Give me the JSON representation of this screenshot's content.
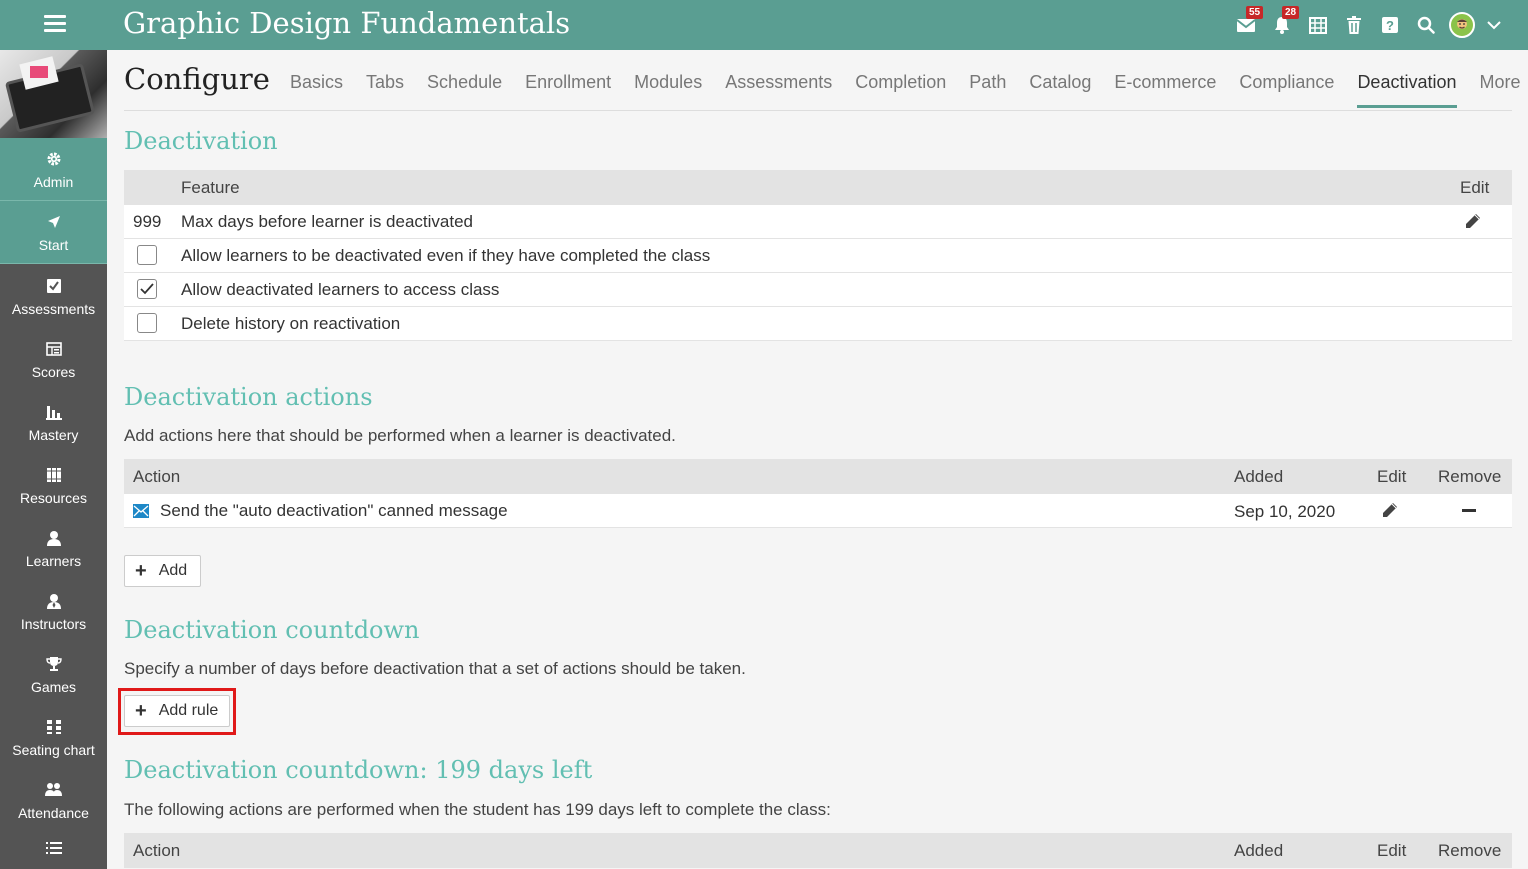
{
  "header": {
    "title": "Graphic Design Fundamentals",
    "mail_badge": "55",
    "notifications_badge": "28"
  },
  "sidebar": {
    "items": [
      {
        "label": "Admin",
        "icon": "gear-icon"
      },
      {
        "label": "Start",
        "icon": "arrow-icon"
      },
      {
        "label": "Assessments",
        "icon": "checklist-icon"
      },
      {
        "label": "Scores",
        "icon": "gradebook-icon"
      },
      {
        "label": "Mastery",
        "icon": "bar-chart-icon"
      },
      {
        "label": "Resources",
        "icon": "books-icon"
      },
      {
        "label": "Learners",
        "icon": "user-icon"
      },
      {
        "label": "Instructors",
        "icon": "instructor-icon"
      },
      {
        "label": "Games",
        "icon": "trophy-icon"
      },
      {
        "label": "Seating chart",
        "icon": "seating-icon"
      },
      {
        "label": "Attendance",
        "icon": "attendance-icon"
      },
      {
        "label": "",
        "icon": "list-icon"
      }
    ]
  },
  "page": {
    "title": "Configure",
    "tabs": [
      "Basics",
      "Tabs",
      "Schedule",
      "Enrollment",
      "Modules",
      "Assessments",
      "Completion",
      "Path",
      "Catalog",
      "E-commerce",
      "Compliance",
      "Deactivation",
      "More"
    ],
    "active_tab": "Deactivation"
  },
  "deactivation": {
    "heading": "Deactivation",
    "col_feature": "Feature",
    "col_edit": "Edit",
    "max_days_value": "999",
    "max_days_label": "Max days before learner is deactivated",
    "options": [
      {
        "label": "Allow learners to be deactivated even if they have completed the class",
        "checked": false
      },
      {
        "label": "Allow deactivated learners to access class",
        "checked": true
      },
      {
        "label": "Delete history on reactivation",
        "checked": false
      }
    ]
  },
  "actions": {
    "heading": "Deactivation actions",
    "description": "Add actions here that should be performed when a learner is deactivated.",
    "col_action": "Action",
    "col_added": "Added",
    "col_edit": "Edit",
    "col_remove": "Remove",
    "rows": [
      {
        "action": "Send the \"auto deactivation\" canned message",
        "added": "Sep 10, 2020"
      }
    ],
    "add_label": "Add"
  },
  "countdown": {
    "heading": "Deactivation countdown",
    "description": "Specify a number of days before deactivation that a set of actions should be taken.",
    "add_rule_label": "Add rule"
  },
  "countdown_rule": {
    "heading": "Deactivation countdown: 199 days left",
    "description": "The following actions are performed when the student has 199 days left to complete the class:",
    "col_action": "Action",
    "col_added": "Added",
    "col_edit": "Edit",
    "col_remove": "Remove"
  },
  "colors": {
    "brand": "#5a9e92",
    "heading": "#62bfb2",
    "sidebar": "#545454",
    "badge": "#c62828",
    "highlight": "#e01919"
  }
}
